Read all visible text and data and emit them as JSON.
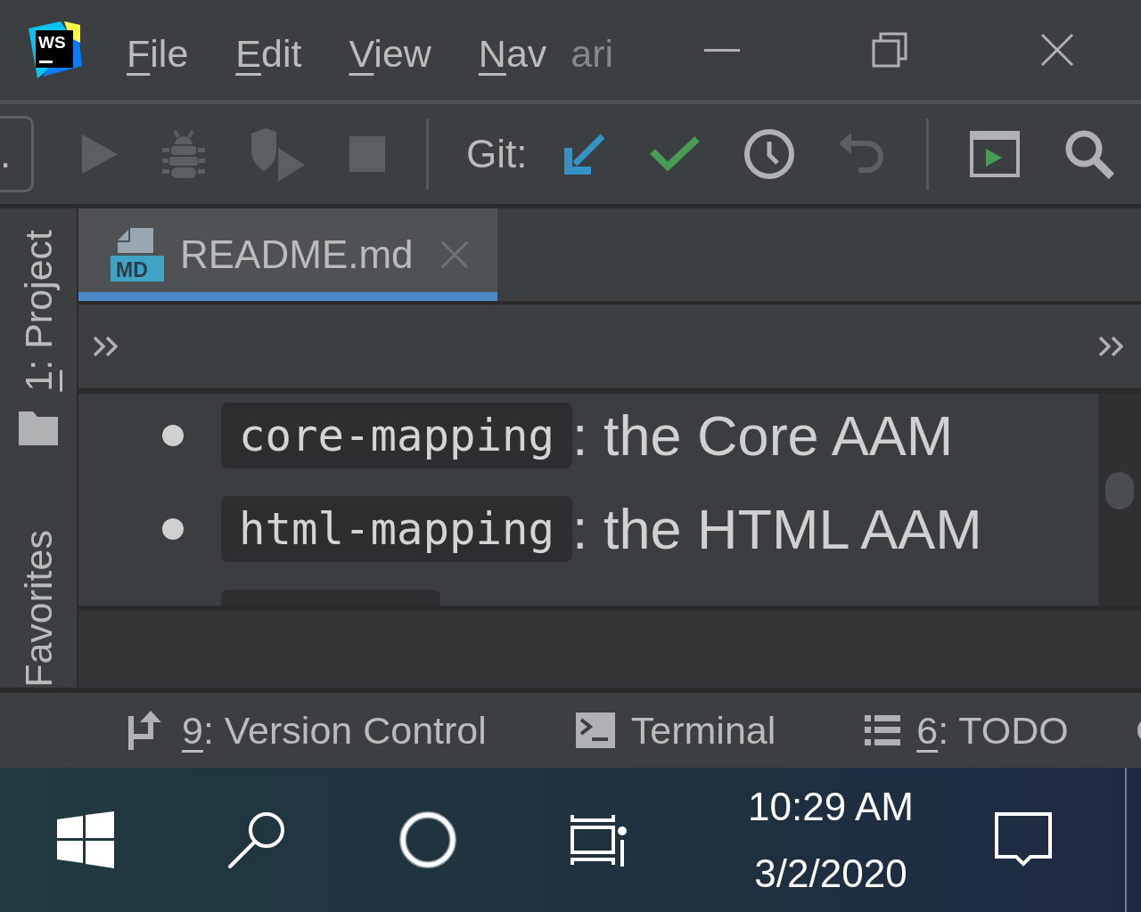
{
  "title_bar": {
    "logo_text": "WS",
    "menu": [
      {
        "label": "File",
        "mnemonic": true,
        "dimmed": false
      },
      {
        "label": "Edit",
        "mnemonic": true,
        "dimmed": false
      },
      {
        "label": "View",
        "mnemonic": true,
        "dimmed": false
      },
      {
        "label": "Nav",
        "mnemonic": true,
        "dimmed": false
      },
      {
        "label": "ari",
        "mnemonic": false,
        "dimmed": true
      }
    ]
  },
  "toolbar": {
    "run_config": {
      "value": "."
    },
    "run_buttons": [
      {
        "disabled": true
      },
      {
        "disabled": true
      },
      {
        "disabled": true
      },
      {
        "disabled": true
      }
    ],
    "git_label": "Git:",
    "git_buttons": [
      {
        "disabled": false
      },
      {
        "disabled": false
      },
      {
        "disabled": false
      },
      {
        "disabled": true
      }
    ]
  },
  "left_strip": [
    {
      "label": "1: Project",
      "mnemonic": true
    },
    {
      "label": "Favorites",
      "mnemonic": false
    }
  ],
  "editor_tabs": [
    {
      "label": "README.md",
      "file_badge": "MD",
      "selected": true
    }
  ],
  "preview": {
    "items": [
      {
        "code": "core-mapping",
        "text": ": the Core AAM"
      },
      {
        "code": "html-mapping",
        "text": ": the HTML AAM"
      }
    ]
  },
  "bottom_bar": [
    {
      "label": "9: Version Control",
      "mnemonic": true
    },
    {
      "label": "Terminal",
      "mnemonic": false
    },
    {
      "label": "6: TODO",
      "mnemonic": true
    }
  ],
  "taskbar": {
    "time": "10:29 AM",
    "date": "3/2/2020"
  }
}
